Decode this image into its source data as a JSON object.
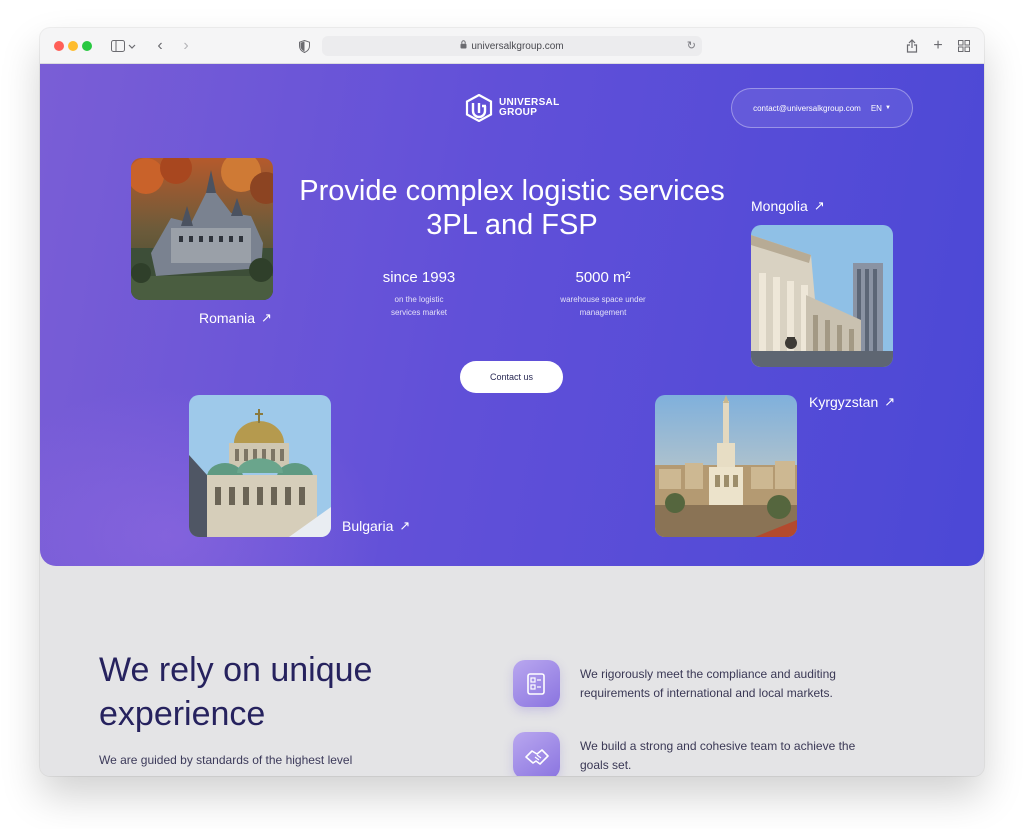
{
  "browser": {
    "url": "universalkgroup.com"
  },
  "header": {
    "logo_line1": "UNIVERSAL",
    "logo_line2": "GROUP",
    "contact_email": "contact@universalkgroup.com",
    "language": "EN"
  },
  "hero": {
    "headline": "Provide complex logistic services 3PL and FSP",
    "stats": [
      {
        "value": "since 1993",
        "caption": "on the logistic\nservices market"
      },
      {
        "value": "5000 m²",
        "caption": "warehouse space under\nmanagement"
      }
    ],
    "cta_label": "Contact us",
    "countries": [
      {
        "name": "Romania"
      },
      {
        "name": "Mongolia"
      },
      {
        "name": "Bulgaria"
      },
      {
        "name": "Kyrgyzstan"
      }
    ]
  },
  "experience": {
    "title": "We rely on unique experience",
    "subtitle": "We are guided by standards of the highest level",
    "features": [
      {
        "text": "We rigorously meet the compliance and auditing requirements of international and local markets."
      },
      {
        "text": "We build a strong and cohesive team to achieve the goals set."
      }
    ]
  }
}
